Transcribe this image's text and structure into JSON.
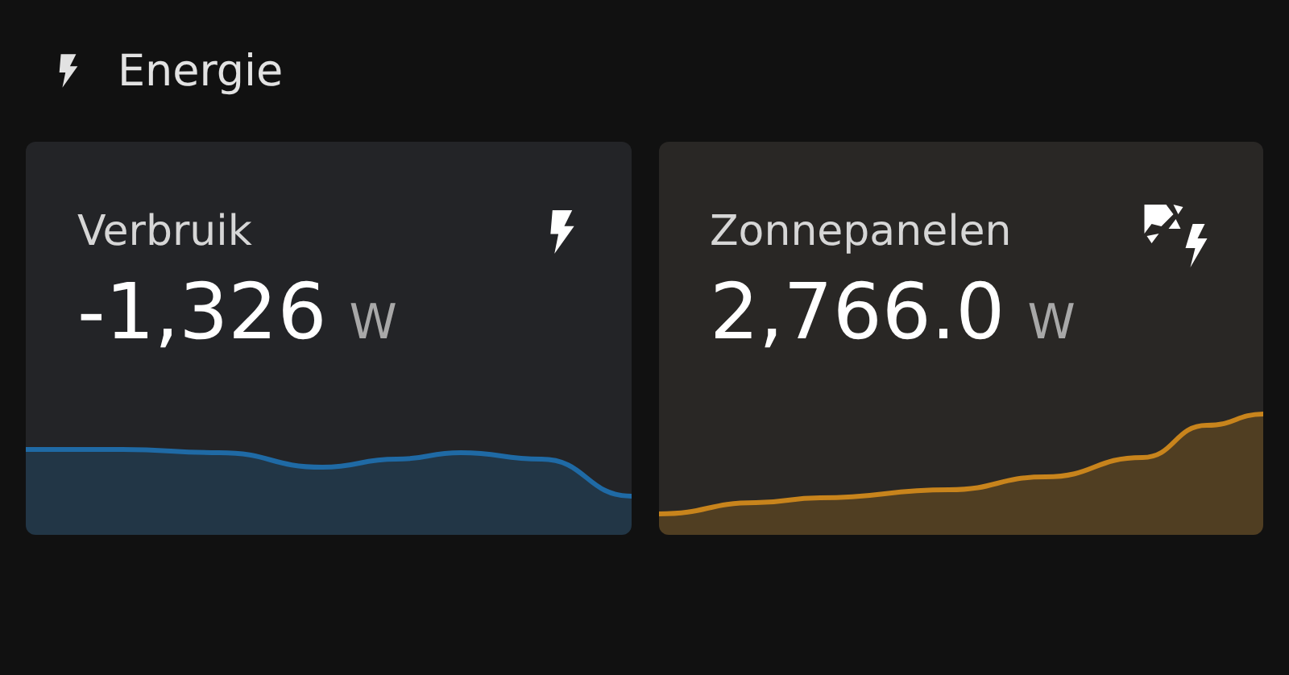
{
  "header": {
    "title": "Energie"
  },
  "cards": [
    {
      "kind": "consumption",
      "title": "Verbruik",
      "value": "-1,326",
      "unit": "W",
      "color": "#1f6aa5"
    },
    {
      "kind": "solar",
      "title": "Zonnepanelen",
      "value": "2,766.0",
      "unit": "W",
      "color": "#c8841c"
    }
  ]
}
